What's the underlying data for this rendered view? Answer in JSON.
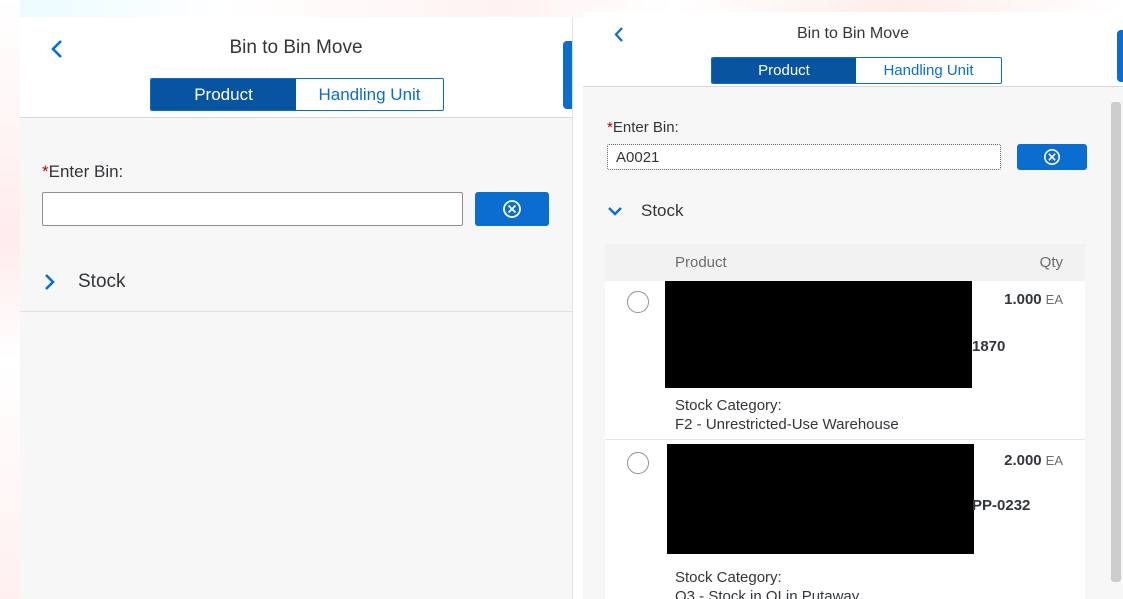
{
  "left": {
    "title": "Bin to Bin Move",
    "tabs": [
      "Product",
      "Handling Unit"
    ],
    "bin_label_req": "*",
    "bin_label": "Enter Bin:",
    "bin_value": "",
    "stock_label": "Stock",
    "stock_expanded": false
  },
  "right": {
    "title": "Bin to Bin Move",
    "tabs": [
      "Product",
      "Handling Unit"
    ],
    "bin_label_req": "*",
    "bin_label": "Enter Bin:",
    "bin_value": "A0021",
    "stock_label": "Stock",
    "stock_expanded": true,
    "table": {
      "columns": [
        "Product",
        "Qty"
      ],
      "rows": [
        {
          "product_tail": "1870",
          "qty": "1.000",
          "unit": "EA",
          "category_label": "Stock Category:",
          "category_value": "F2 - Unrestricted-Use Warehouse"
        },
        {
          "product_tail": "PP-0232",
          "qty": "2.000",
          "unit": "EA",
          "category_label": "Stock Category:",
          "category_value": "Q3 - Stock in QI in Putaway"
        }
      ]
    }
  },
  "icons": {
    "back": "chevron-left-icon",
    "clear": "clear-circle-icon",
    "expand_collapsed": "chevron-right-icon",
    "expand_open": "chevron-down-icon"
  },
  "colors": {
    "accent": "#0a6ed1",
    "segment_active": "#0854a0",
    "required": "#bb0000"
  }
}
